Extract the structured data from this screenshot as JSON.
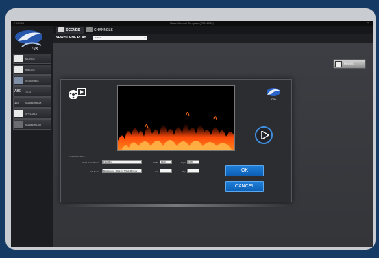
{
  "window": {
    "title": "BlazeChannel Template (720x1080)",
    "menu": "≡ MENU",
    "close_glyph": "×"
  },
  "sidebar": {
    "items": [
      {
        "label": "MOVIES",
        "icon": "film-reel-icon"
      },
      {
        "label": "IMAGES",
        "icon": "images-icon"
      },
      {
        "label": "SEGMENTS",
        "icon": "segments-icon"
      },
      {
        "label": "TEXT",
        "icon": "text-abc-icon"
      },
      {
        "label": "NUMBER BOX",
        "icon": "number-box-icon"
      },
      {
        "label": "SPECIALS",
        "icon": "specials-icon"
      },
      {
        "label": "NUMBER LIST",
        "icon": "number-list-icon"
      }
    ]
  },
  "tabs": [
    {
      "label": "SCENES",
      "icon": "scenes-icon",
      "active": true
    },
    {
      "label": "CHANNELS",
      "icon": "channels-icon",
      "active": false
    }
  ],
  "scene_bar": {
    "label": "NEW SCENE",
    "play_label": "PLAY",
    "select_value": "Default"
  },
  "workspace": {
    "preview_button": "MOVIES"
  },
  "dialog": {
    "section_title": "Properties Name",
    "media_name_label": "Media Name/Name",
    "media_name_value": "Fire0001",
    "file_name_label": "File Name",
    "file_name_value": "Background_FIRE_1_720x1080.mov",
    "width_label": "Width",
    "width_value": "1920",
    "height_label": "Height",
    "height_value": "1080",
    "left_label": "Left",
    "left_value": "",
    "top_label": "Top",
    "top_value": "",
    "ok_label": "OK",
    "cancel_label": "CANCEL"
  },
  "colors": {
    "page_bg": "#153a63",
    "accent": "#1f7fd8",
    "fire": "#ff6a1a"
  }
}
